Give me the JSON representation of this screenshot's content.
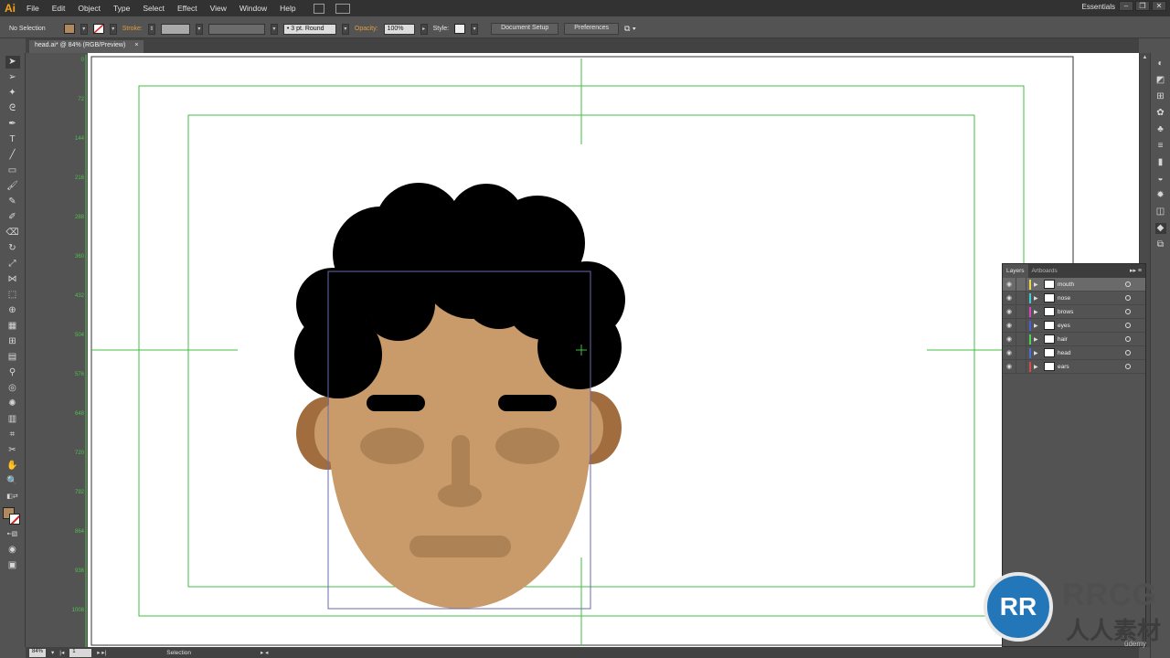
{
  "app": {
    "logo": "Ai",
    "workspace": "Essentials"
  },
  "menu": [
    "File",
    "Edit",
    "Object",
    "Type",
    "Select",
    "Effect",
    "View",
    "Window",
    "Help"
  ],
  "control_bar": {
    "selection": "No Selection",
    "stroke_label": "Stroke:",
    "brush": "• 3 pt. Round",
    "opacity_label": "Opacity:",
    "opacity_value": "100%",
    "style_label": "Style:",
    "document_setup": "Document Setup",
    "preferences": "Preferences",
    "fill_color": "#b08a5e"
  },
  "document": {
    "tab_title": "head.ai* @ 84% (RGB/Preview)",
    "close": "×"
  },
  "ruler": [
    "0",
    "72",
    "144",
    "216",
    "288",
    "360",
    "432",
    "504",
    "576",
    "648",
    "720",
    "792",
    "864",
    "936",
    "1008"
  ],
  "layers_panel": {
    "tab_layers": "Layers",
    "tab_artboards": "Artboards",
    "layers": [
      {
        "name": "mouth",
        "color": "#e8d34a",
        "selected": true
      },
      {
        "name": "nose",
        "color": "#45c8d6",
        "selected": false
      },
      {
        "name": "brows",
        "color": "#d645c4",
        "selected": false
      },
      {
        "name": "eyes",
        "color": "#4a5ed6",
        "selected": false
      },
      {
        "name": "hair",
        "color": "#45d64e",
        "selected": false
      },
      {
        "name": "head",
        "color": "#4a6ed6",
        "selected": false
      },
      {
        "name": "ears",
        "color": "#d64a4a",
        "selected": false
      }
    ]
  },
  "status_bar": {
    "zoom": "84%",
    "page": "1",
    "mode": "Selection"
  },
  "watermark": {
    "logo": "RR",
    "title": "RRCG",
    "subtitle": "人人素材",
    "brand": "üdemy"
  },
  "colors": {
    "skin": "#c99b6a",
    "shade": "#ad8254",
    "ear_outer": "#a26d3e",
    "ear_inner": "#c99b6a",
    "hair": "#000000",
    "guide": "#3fbf3f",
    "bbox": "#6a6ab0"
  }
}
